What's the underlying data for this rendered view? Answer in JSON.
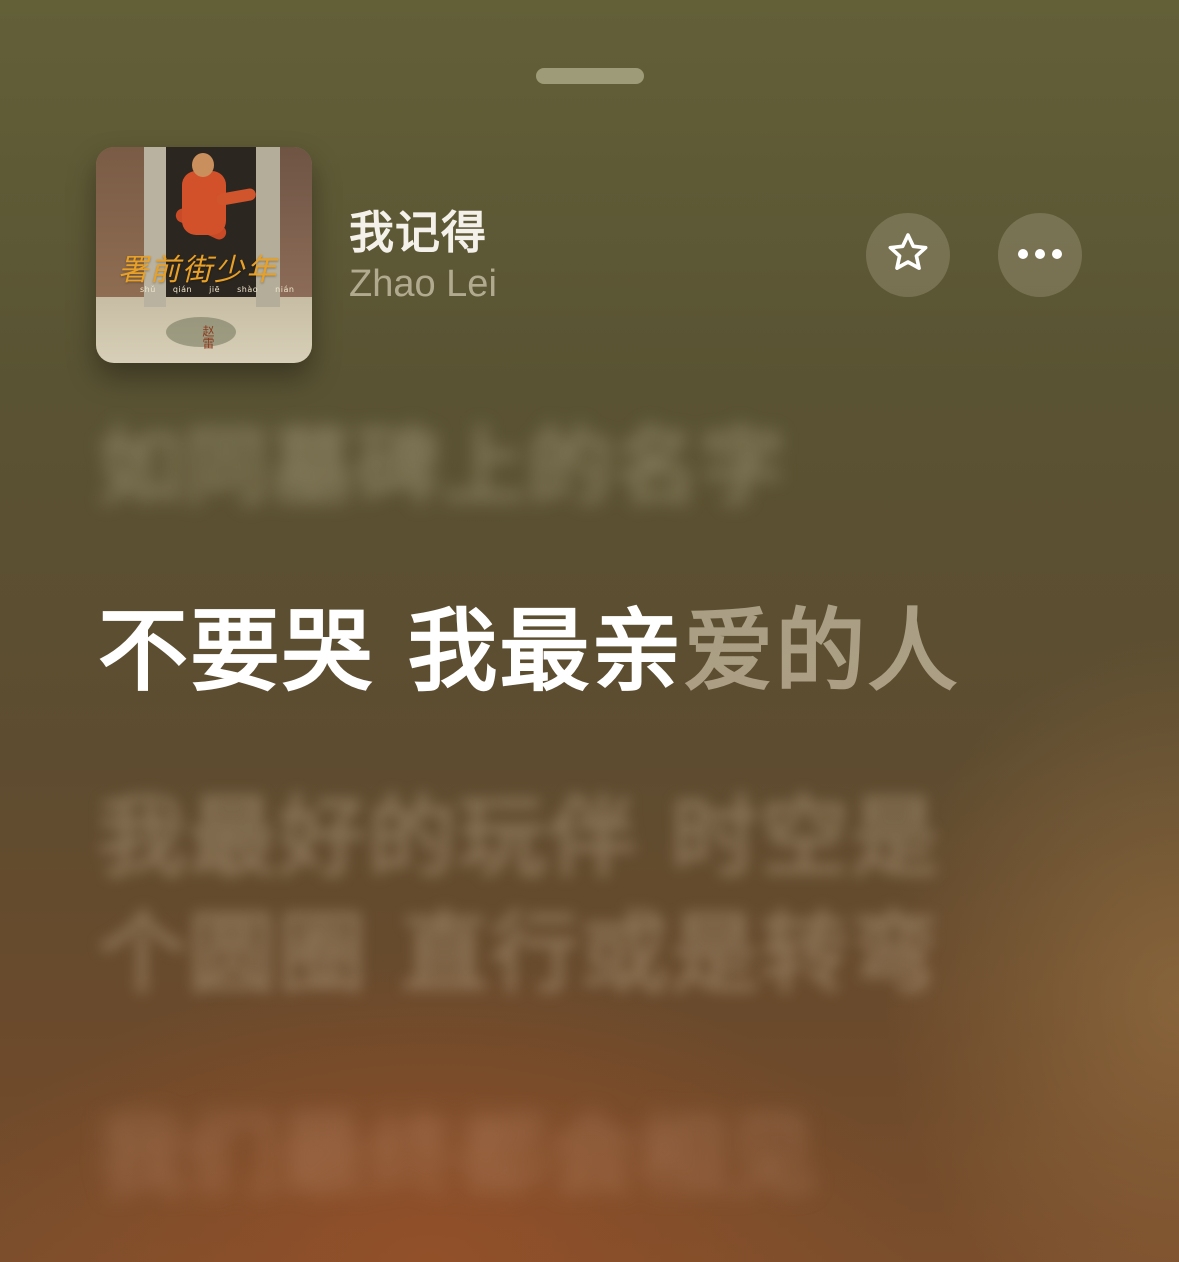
{
  "now_playing": {
    "title": "我记得",
    "artist": "Zhao Lei",
    "artwork": {
      "title": "署前街少年",
      "pinyin": "shǔ qián jiē shào nián",
      "artist": "赵雷"
    }
  },
  "controls": {
    "favorite_icon": "star-outline-icon",
    "more_icon": "ellipsis-icon"
  },
  "lyrics": {
    "previous": "如同墓碑上的名字",
    "current_sung": "不要哭 我最亲",
    "current_unsung": "爱的人",
    "next_line_1": "我最好的玩伴 时空是",
    "next_line_2": "个圆圈 直行或是转弯",
    "following": "我们最终都会相见"
  },
  "colors": {
    "background_top": "#636038",
    "background_bottom": "#7a4e2c",
    "lyric_active": "#ffffff"
  }
}
